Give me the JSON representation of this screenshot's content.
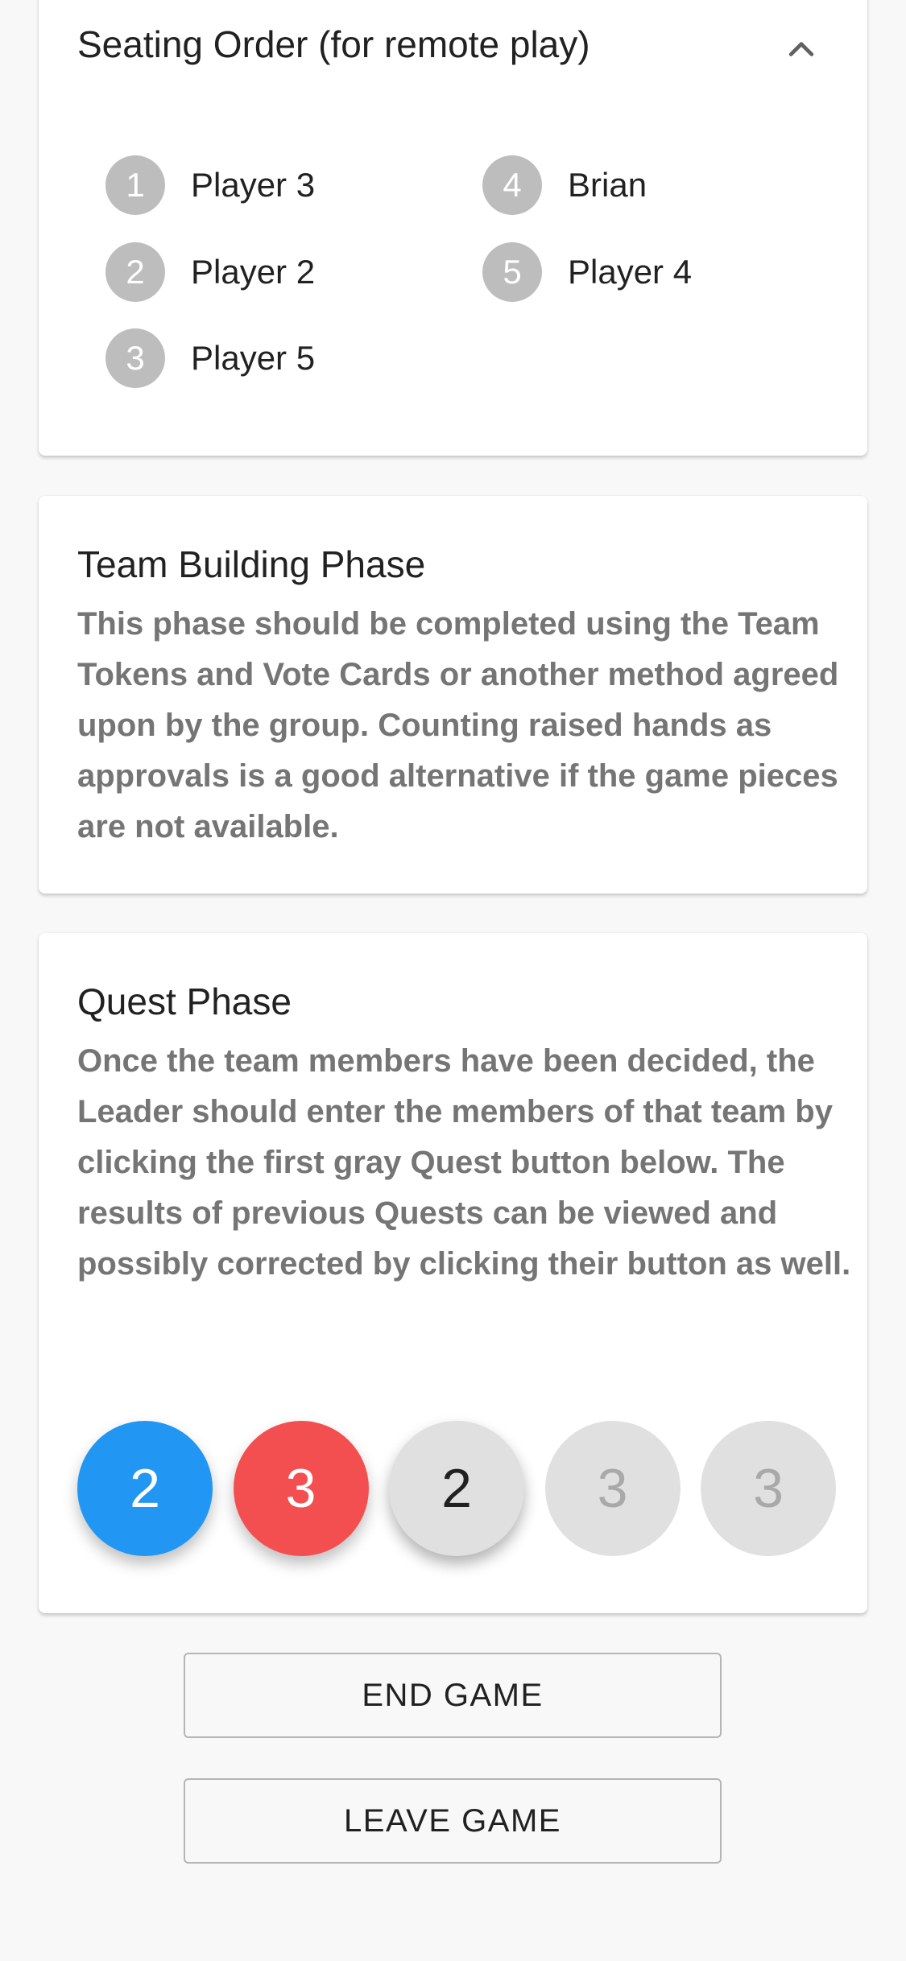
{
  "seating": {
    "title": "Seating Order (for remote play)",
    "players": [
      {
        "num": "1",
        "name": "Player 3"
      },
      {
        "num": "2",
        "name": "Player 2"
      },
      {
        "num": "3",
        "name": "Player 5"
      },
      {
        "num": "4",
        "name": "Brian"
      },
      {
        "num": "5",
        "name": "Player 4"
      }
    ]
  },
  "team_phase": {
    "title": "Team Building Phase",
    "body": "This phase should be completed using the Team Tokens and Vote Cards or another method agreed upon by the group. Counting raised hands as approvals is a good alternative if the game pieces are not available."
  },
  "quest_phase": {
    "title": "Quest Phase",
    "body": "Once the team members have been decided, the Leader should enter the members of that team by clicking the first gray Quest button below. The results of previous Quests can be viewed and possibly corrected by clicking their button as well.",
    "quests": [
      {
        "size": "2",
        "state": "success"
      },
      {
        "size": "3",
        "state": "fail"
      },
      {
        "size": "2",
        "state": "active"
      },
      {
        "size": "3",
        "state": "pending"
      },
      {
        "size": "3",
        "state": "pending"
      }
    ]
  },
  "actions": {
    "end_game": "END GAME",
    "leave_game": "LEAVE GAME"
  },
  "colors": {
    "success": "#2196f3",
    "fail": "#f44f50",
    "active": "#e0e0e0",
    "pending": "#e0e0e0",
    "seat_badge": "#bdbdbd"
  }
}
